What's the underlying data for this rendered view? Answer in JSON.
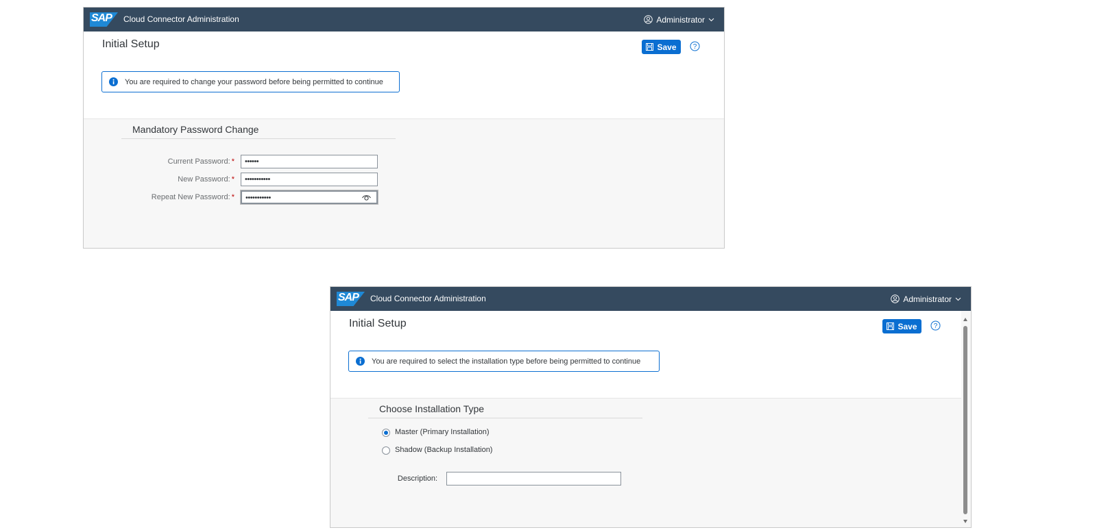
{
  "colors": {
    "shell_bar": "#354a5f",
    "brand_logo": "#1f89d6",
    "accent": "#0a6ed1",
    "required": "#bb0000",
    "page_background": "#f7f7f7"
  },
  "windows": [
    {
      "shell": {
        "logo_text": "SAP",
        "title": "Cloud Connector Administration",
        "user": "Administrator"
      },
      "header": {
        "title": "Initial Setup",
        "save_label": "Save",
        "message": "You are required to change your password before being permitted to continue"
      },
      "form": {
        "title": "Mandatory Password Change",
        "fields": [
          {
            "label": "Current Password:",
            "required_mark": "*",
            "value": "••••••"
          },
          {
            "label": "New Password:",
            "required_mark": "*",
            "value": "•••••••••••"
          },
          {
            "label": "Repeat New Password:",
            "required_mark": "*",
            "value": "•••••••••••"
          }
        ]
      }
    },
    {
      "shell": {
        "logo_text": "SAP",
        "title": "Cloud Connector Administration",
        "user": "Administrator"
      },
      "header": {
        "title": "Initial Setup",
        "save_label": "Save",
        "message": "You are required to select the installation type before being permitted to continue"
      },
      "form": {
        "title": "Choose Installation Type",
        "options": [
          {
            "label": "Master (Primary Installation)",
            "selected": true
          },
          {
            "label": "Shadow (Backup Installation)",
            "selected": false
          }
        ],
        "description_label": "Description:",
        "description_value": ""
      }
    }
  ]
}
